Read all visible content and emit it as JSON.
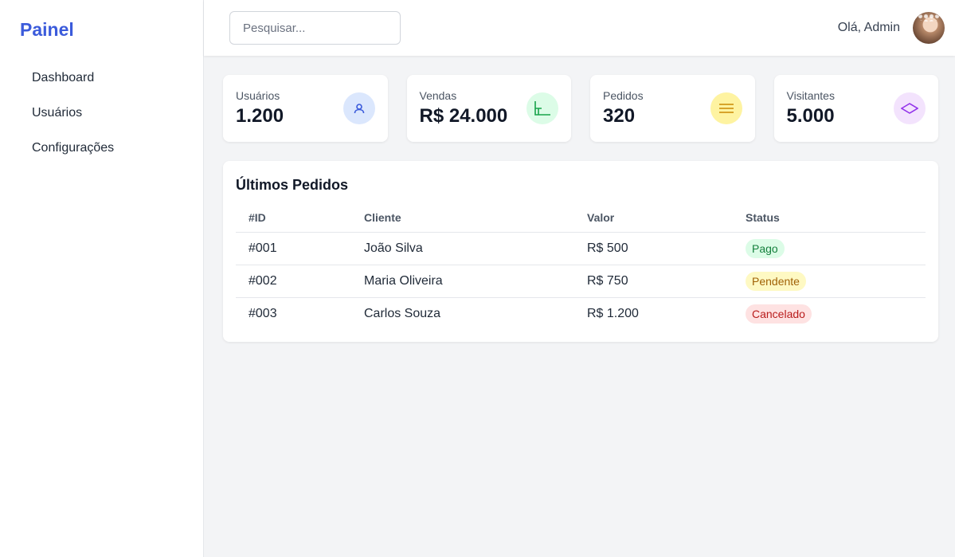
{
  "sidebar": {
    "brand": "Painel",
    "items": [
      {
        "label": "Dashboard"
      },
      {
        "label": "Usuários"
      },
      {
        "label": "Configurações"
      }
    ]
  },
  "topbar": {
    "search_placeholder": "Pesquisar...",
    "greeting": "Olá, Admin"
  },
  "stats": [
    {
      "label": "Usuários",
      "value": "1.200",
      "icon": "user-icon",
      "bg": "#dbe7fd",
      "fg": "#3b5bdb"
    },
    {
      "label": "Vendas",
      "value": "R$ 24.000",
      "icon": "chart-icon",
      "bg": "#dcfce7",
      "fg": "#16a34a"
    },
    {
      "label": "Pedidos",
      "value": "320",
      "icon": "list-icon",
      "bg": "#fef3a1",
      "fg": "#ca8a04"
    },
    {
      "label": "Visitantes",
      "value": "5.000",
      "icon": "eye-icon",
      "bg": "#f3e3fd",
      "fg": "#9333ea"
    }
  ],
  "orders": {
    "title": "Últimos Pedidos",
    "columns": [
      "#ID",
      "Cliente",
      "Valor",
      "Status"
    ],
    "rows": [
      {
        "id": "#001",
        "client": "João Silva",
        "value": "R$ 500",
        "status": "Pago",
        "status_bg": "#dcfce7",
        "status_fg": "#15803d"
      },
      {
        "id": "#002",
        "client": "Maria Oliveira",
        "value": "R$ 750",
        "status": "Pendente",
        "status_bg": "#fef9c3",
        "status_fg": "#a16207"
      },
      {
        "id": "#003",
        "client": "Carlos Souza",
        "value": "R$ 1.200",
        "status": "Cancelado",
        "status_bg": "#fee2e2",
        "status_fg": "#b91c1c"
      }
    ]
  }
}
